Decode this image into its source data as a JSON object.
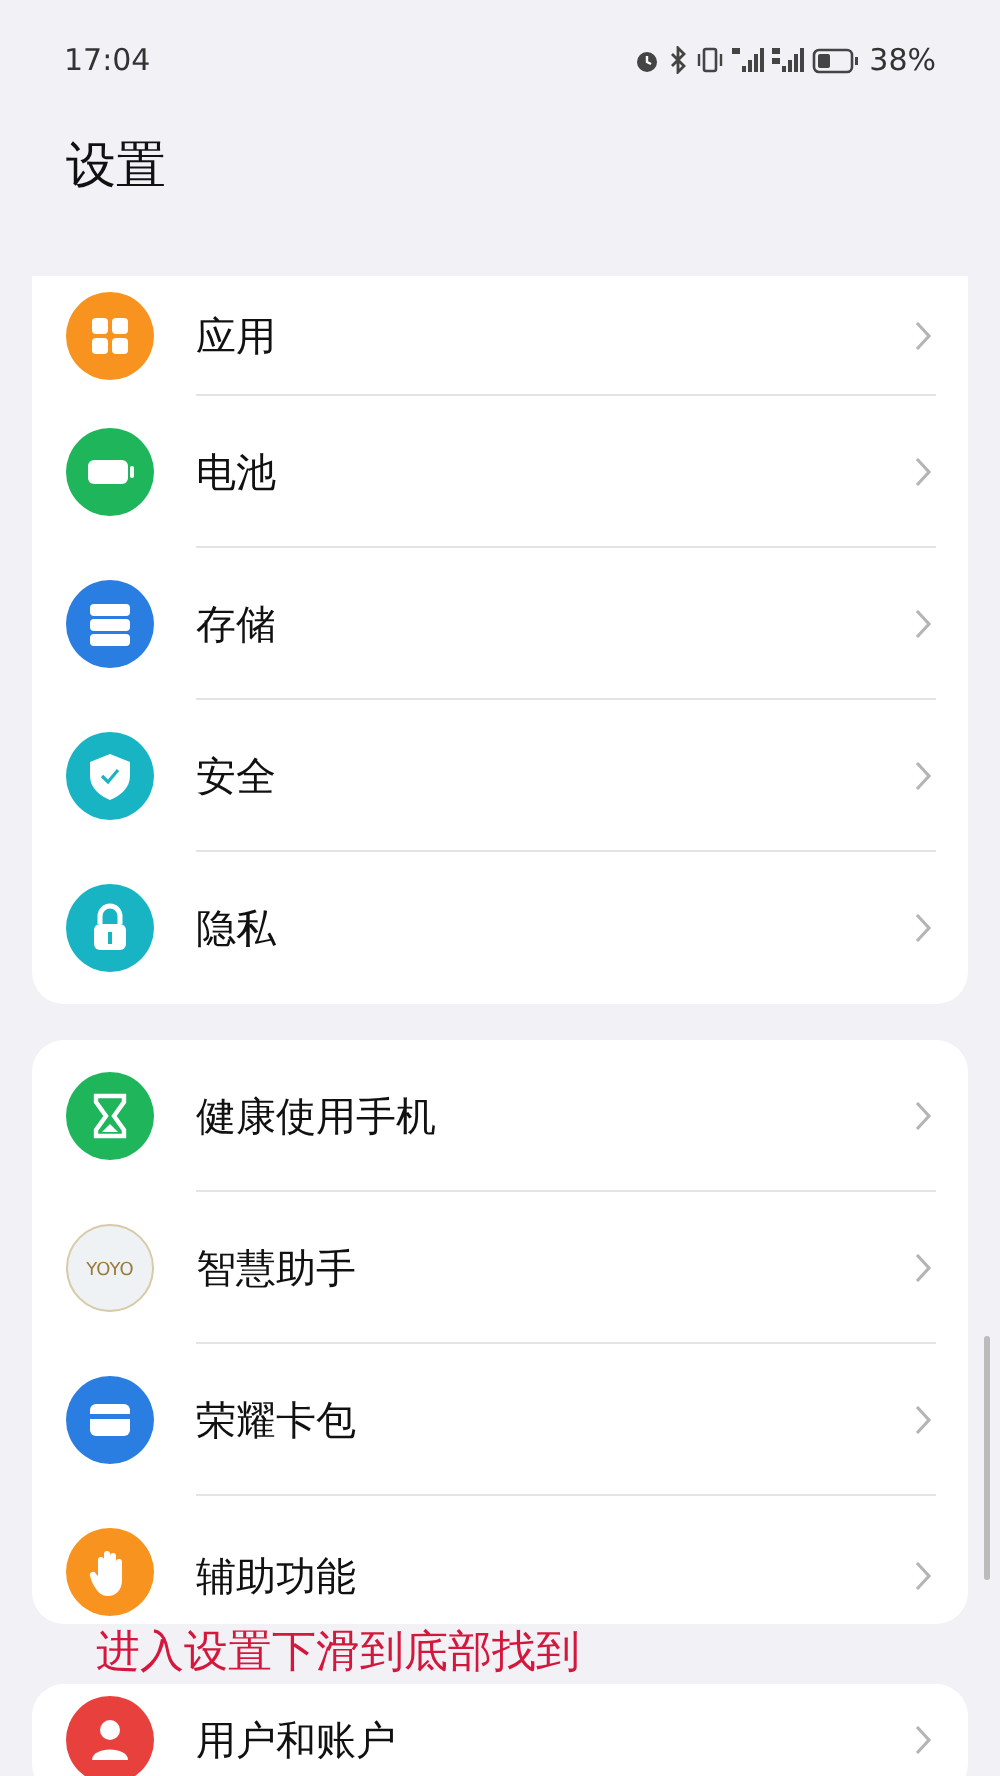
{
  "status_bar": {
    "time": "17:04",
    "battery": "38%"
  },
  "title": "设置",
  "groups": [
    {
      "items": [
        {
          "label": "应用",
          "kind": "apps"
        },
        {
          "label": "电池",
          "kind": "battery"
        },
        {
          "label": "存储",
          "kind": "storage"
        },
        {
          "label": "安全",
          "kind": "security"
        },
        {
          "label": "隐私",
          "kind": "privacy"
        }
      ]
    },
    {
      "items": [
        {
          "label": "健康使用手机",
          "kind": "wellbeing"
        },
        {
          "label": "智慧助手",
          "kind": "assistant",
          "icon_text": "YOYO"
        },
        {
          "label": "荣耀卡包",
          "kind": "wallet"
        },
        {
          "label": "辅助功能",
          "kind": "accessibility"
        }
      ]
    },
    {
      "items": [
        {
          "label": "用户和账户",
          "kind": "accounts"
        }
      ]
    }
  ],
  "caption": "进入设置下滑到底部找到"
}
